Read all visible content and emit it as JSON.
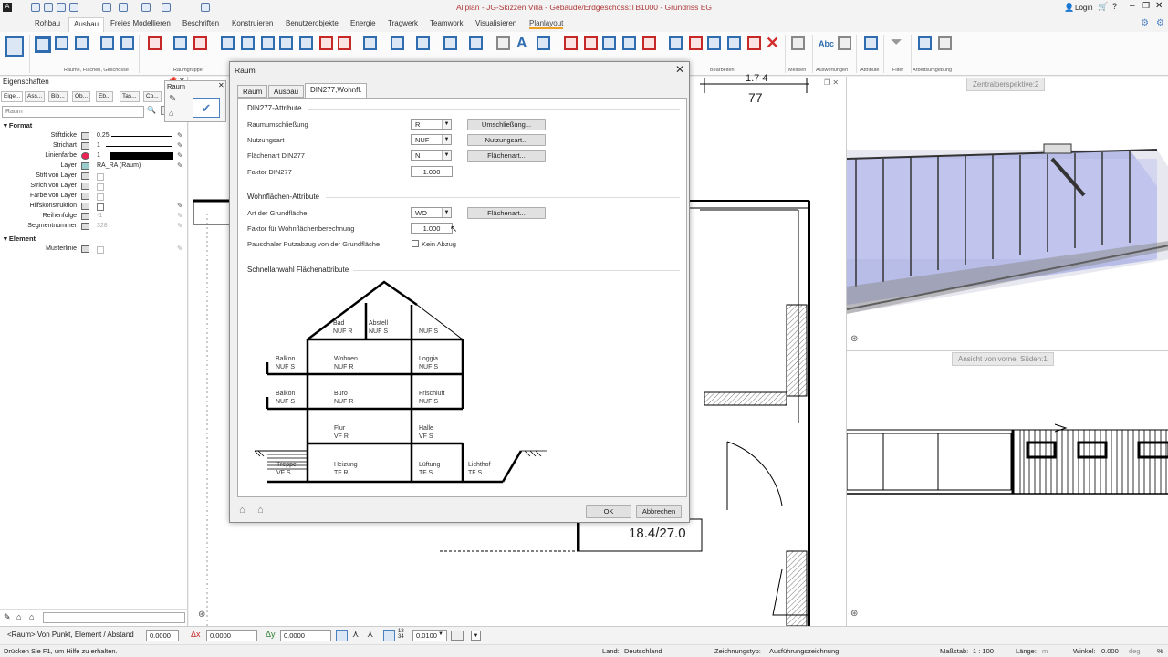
{
  "app": {
    "title": "Allplan - JG-Skizzen Villa - Gebäude/Erdgeschoss:TB1000 - Grundriss EG",
    "login_label": "Login"
  },
  "ribbon": {
    "tabs": [
      "Rohbau",
      "Ausbau",
      "Freies Modellieren",
      "Beschriften",
      "Konstruieren",
      "Benutzerobjekte",
      "Energie",
      "Tragwerk",
      "Teamwork",
      "Visualisieren",
      "Planlayout"
    ],
    "active_tab": "Ausbau",
    "groups": [
      "Räume, Flächen, Geschosse",
      "Raumgruppe",
      "Bearbeiten",
      "Messen",
      "Auswertungen",
      "Attribute",
      "Filter",
      "Arbeitsumgebung"
    ]
  },
  "properties": {
    "title": "Eigenschaften",
    "tabs": [
      "Eige...",
      "Ass...",
      "Bib...",
      "Ob...",
      "Eb...",
      "Tas...",
      "Co..."
    ],
    "search_placeholder": "Raum",
    "format_section": "Format",
    "element_section": "Element",
    "rows": [
      {
        "label": "Stiftdicke",
        "value": "0.25"
      },
      {
        "label": "Strichart",
        "value": "1"
      },
      {
        "label": "Linienfarbe",
        "value": "1"
      },
      {
        "label": "Layer",
        "value": "RA_RA (Raum)"
      },
      {
        "label": "Stift von Layer",
        "value": ""
      },
      {
        "label": "Strich von Layer",
        "value": ""
      },
      {
        "label": "Farbe von Layer",
        "value": ""
      },
      {
        "label": "Hilfskonstruktion",
        "value": ""
      },
      {
        "label": "Reihenfolge",
        "value": "-1"
      },
      {
        "label": "Segmentnummer",
        "value": "328"
      }
    ],
    "element_rows": [
      {
        "label": "Musterlinie",
        "value": ""
      }
    ],
    "accent_color": "#000000"
  },
  "palette": {
    "title": "Raum"
  },
  "dialog": {
    "title": "Raum",
    "tabs": [
      "Raum",
      "Ausbau",
      "DIN277,Wohnfl."
    ],
    "active_tab": "DIN277,Wohnfl.",
    "din_group": "DIN277-Attribute",
    "din_fields": [
      {
        "label": "Raumumschließung",
        "value": "R",
        "button": "Umschließung..."
      },
      {
        "label": "Nutzungsart",
        "value": "NUF",
        "button": "Nutzungsart..."
      },
      {
        "label": "Flächenart DIN277",
        "value": "N",
        "button": "Flächenart..."
      }
    ],
    "faktor_din_label": "Faktor DIN277",
    "faktor_din_value": "1.000",
    "wohn_group": "Wohnflächen-Attribute",
    "grundflaeche_label": "Art der Grundfläche",
    "grundflaeche_value": "WO",
    "grundflaeche_button": "Flächenart...",
    "faktor_wohn_label": "Faktor für Wohnflächenberechnung",
    "faktor_wohn_value": "1.000",
    "putzabzug_label": "Pauschaler Putzabzug von der Grundfläche",
    "putzabzug_check_label": "Kein Abzug",
    "schnell_group": "Schnellanwahl Flächenattribute",
    "house": [
      {
        "name": "Bad",
        "code": "NUF R"
      },
      {
        "name": "Abstell",
        "code": "NUF S"
      },
      {
        "name": "",
        "code": "NUF S"
      },
      {
        "name": "Balkon",
        "code": "NUF S"
      },
      {
        "name": "Wohnen",
        "code": "NUF R"
      },
      {
        "name": "Loggia",
        "code": "NUF S"
      },
      {
        "name": "Balkon",
        "code": "NUF S"
      },
      {
        "name": "Büro",
        "code": "NUF R"
      },
      {
        "name": "Frischluft",
        "code": "NUF S"
      },
      {
        "name": "Flur",
        "code": "VF R"
      },
      {
        "name": "Halle",
        "code": "VF S"
      },
      {
        "name": "Treppe",
        "code": "VF S"
      },
      {
        "name": "Heizung",
        "code": "TF R"
      },
      {
        "name": "Lüftung",
        "code": "TF S"
      },
      {
        "name": "Lichthof",
        "code": "TF S"
      }
    ],
    "ok_label": "OK",
    "cancel_label": "Abbrechen"
  },
  "canvas": {
    "dimension_top": "77",
    "dimension_top_partial": "1.7 4",
    "room_label": "18.4/27.0"
  },
  "views": {
    "perspective_label": "Zentralperspektive:2",
    "south_label": "Ansicht von vorne, Süden:1"
  },
  "command_bar": {
    "prompt": "<Raum> Von Punkt, Element / Abstand",
    "value": "0.0000",
    "dx_label": "Δx",
    "dx_value": "0.0000",
    "dy_label": "Δy",
    "dy_value": "0.0000",
    "snap_value": "0.0100"
  },
  "status": {
    "help": "Drücken Sie F1, um Hilfe zu erhalten.",
    "land_label": "Land:",
    "land_value": "Deutschland",
    "zeichnungstyp_label": "Zeichnungstyp:",
    "zeichnungstyp_value": "Ausführungszeichnung",
    "massstab_label": "Maßstab:",
    "massstab_value": "1 : 100",
    "laenge_label": "Länge:",
    "laenge_value": "m",
    "winkel_label": "Winkel:",
    "winkel_value": "0.000",
    "winkel_unit": "deg",
    "extra": "%"
  }
}
